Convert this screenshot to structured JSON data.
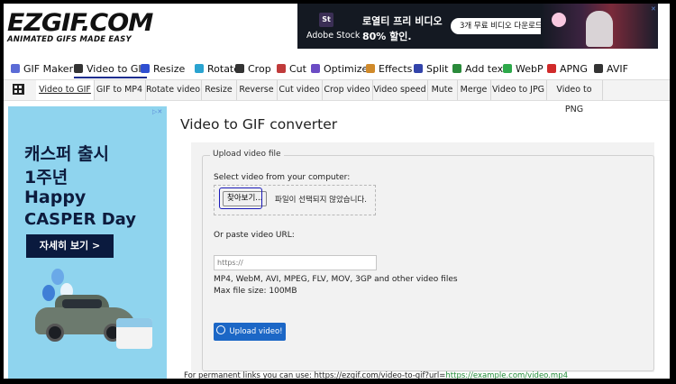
{
  "header": {
    "logo_title": "EZGIF.COM",
    "logo_tagline": "ANIMATED GIFS MADE EASY",
    "banner": {
      "brand_badge": "St",
      "brand": "Adobe Stock",
      "title_line1": "로열티 프리 비디오",
      "title_line2": "80% 할인.",
      "cta": "3개 무료 비디오 다운로드"
    }
  },
  "main_nav": [
    {
      "label": "GIF Maker",
      "icon": "gif-maker-icon",
      "color": "#5b6bd6"
    },
    {
      "label": "Video to GIF",
      "icon": "video-to-gif-icon",
      "color": "#333333",
      "active": true
    },
    {
      "label": "Resize",
      "icon": "resize-icon",
      "color": "#2f4fd1"
    },
    {
      "label": "Rotate",
      "icon": "rotate-icon",
      "color": "#2aa3d0"
    },
    {
      "label": "Crop",
      "icon": "crop-icon",
      "color": "#333333"
    },
    {
      "label": "Cut",
      "icon": "cut-icon",
      "color": "#c03a3a"
    },
    {
      "label": "Optimize",
      "icon": "optimize-icon",
      "color": "#6b4cc4"
    },
    {
      "label": "Effects",
      "icon": "effects-icon",
      "color": "#d08a2a"
    },
    {
      "label": "Split",
      "icon": "split-icon",
      "color": "#3344aa"
    },
    {
      "label": "Add text",
      "icon": "add-text-icon",
      "color": "#2a8a3a"
    },
    {
      "label": "WebP",
      "icon": "webp-icon",
      "color": "#2da84a"
    },
    {
      "label": "APNG",
      "icon": "apng-icon",
      "color": "#d02a2a"
    },
    {
      "label": "AVIF",
      "icon": "avif-icon",
      "color": "#333333"
    }
  ],
  "sub_nav": [
    {
      "label": "Video to GIF",
      "active": true
    },
    {
      "label": "GIF to MP4"
    },
    {
      "label": "Rotate video"
    },
    {
      "label": "Resize"
    },
    {
      "label": "Reverse"
    },
    {
      "label": "Cut video"
    },
    {
      "label": "Crop video"
    },
    {
      "label": "Video speed"
    },
    {
      "label": "Mute"
    },
    {
      "label": "Merge"
    },
    {
      "label": "Video to JPG"
    },
    {
      "label": "Video to PNG"
    }
  ],
  "side_ad": {
    "line1": "캐스퍼 출시",
    "line2": "1주년",
    "line3": "Happy",
    "line4": "CASPER Day",
    "button": "자세히 보기 >"
  },
  "main": {
    "title": "Video to GIF converter",
    "upload_legend": "Upload video file",
    "select_label": "Select video from your computer:",
    "file_button": "찾아보기...",
    "no_file_text": "파일이 선택되지 않았습니다.",
    "url_label": "Or paste video URL:",
    "url_placeholder": "https://",
    "formats_text": "MP4, WebM, AVI, MPEG, FLV, MOV, 3GP and other video files",
    "max_size_text": "Max file size: 100MB",
    "upload_button": "Upload video!",
    "footer_text": "For permanent links you can use: https://ezgif.com/video-to-gif?url=",
    "footer_link": "https://example.com/video.mp4"
  }
}
